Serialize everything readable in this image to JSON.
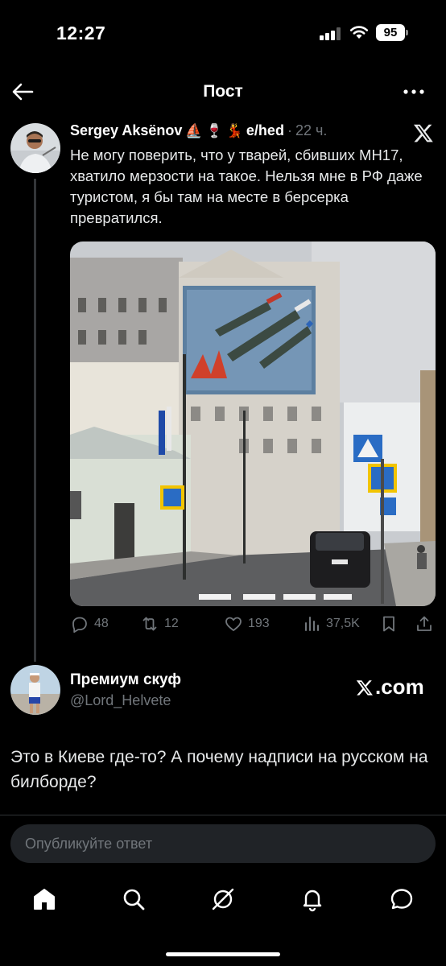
{
  "status_bar": {
    "time": "12:27",
    "battery": "95"
  },
  "header": {
    "title": "Пост"
  },
  "tweet": {
    "author_name": "Sergey Aksënov",
    "emojis": [
      "⛵",
      "🍷",
      "💃"
    ],
    "handle": "e/hed",
    "time": "22 ч.",
    "text": "Не могу поверить, что у тварей, сбивших МН17, хватило мерзости на такое. Нельзя мне в РФ даже туристом, я бы там на месте в берсерка превратился.",
    "image_alt": "street-photo-billboard",
    "stats": {
      "replies": "48",
      "reposts": "12",
      "likes": "193",
      "views": "37,5K"
    }
  },
  "reply": {
    "name": "Премиум скуф",
    "handle": "@Lord_Helvete",
    "source": ".com",
    "text": "Это в Киеве где-то? А почему надписи на русском на билборде?"
  },
  "compose": {
    "placeholder": "Опубликуйте ответ"
  },
  "tabs": [
    "home",
    "search",
    "grok",
    "notifications",
    "messages"
  ],
  "colors": {
    "background": "#000000",
    "text": "#e7e9ea",
    "muted": "#71767b",
    "compose_bg": "#202327"
  }
}
